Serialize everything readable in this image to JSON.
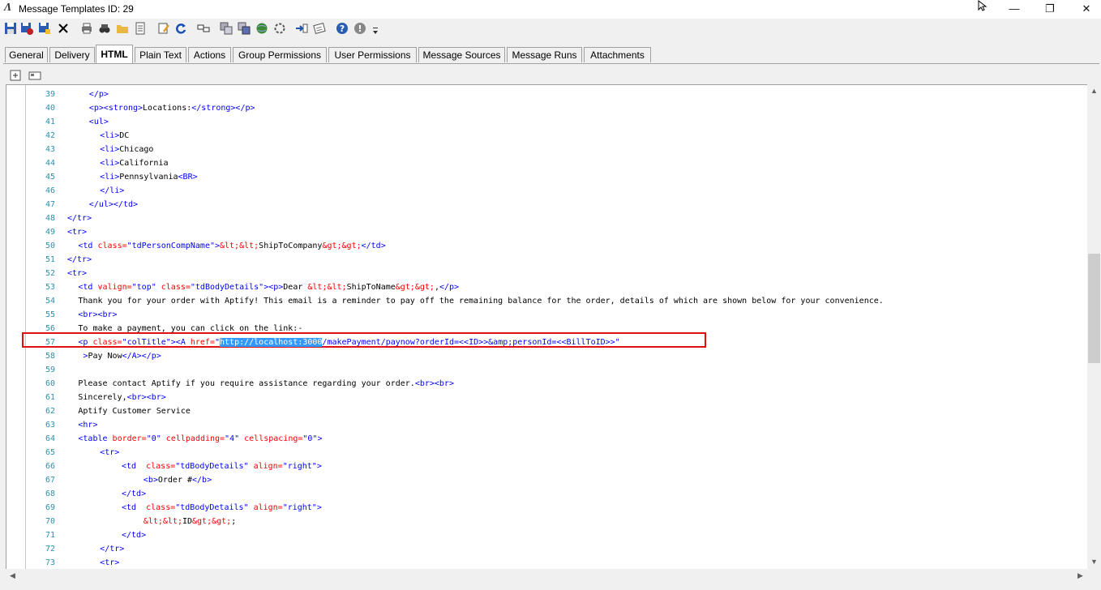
{
  "window": {
    "title": "Message Templates ID: 29",
    "minimize": "—",
    "restore": "❐",
    "close": "✕"
  },
  "toolbar": {
    "icons": [
      "save-icon",
      "save-close-icon",
      "save-new-icon",
      "delete-icon",
      "print-icon",
      "find-icon",
      "open-folder-icon",
      "properties-icon",
      "edit-icon",
      "refresh-icon",
      "link-icon",
      "copy-icon",
      "paste-icon",
      "web-icon",
      "settings-icon",
      "import-icon",
      "notes-icon",
      "help-icon",
      "info-icon",
      "dropdown-icon"
    ]
  },
  "tabs": [
    {
      "label": "General",
      "active": false
    },
    {
      "label": "Delivery",
      "active": false
    },
    {
      "label": "HTML",
      "active": true
    },
    {
      "label": "Plain Text",
      "active": false
    },
    {
      "label": "Actions",
      "active": false
    },
    {
      "label": "Group Permissions",
      "active": false
    },
    {
      "label": "User Permissions",
      "active": false
    },
    {
      "label": "Message Sources",
      "active": false
    },
    {
      "label": "Message Runs",
      "active": false
    },
    {
      "label": "Attachments",
      "active": false
    }
  ],
  "editor": {
    "lines": [
      {
        "n": "39",
        "indent": 2,
        "parts": [
          [
            "t",
            "</p>"
          ]
        ]
      },
      {
        "n": "40",
        "indent": 2,
        "parts": [
          [
            "t",
            "<p><strong>"
          ],
          [
            "x",
            "Locations:"
          ],
          [
            "t",
            "</strong></p>"
          ]
        ]
      },
      {
        "n": "41",
        "indent": 2,
        "parts": [
          [
            "t",
            "<ul>"
          ]
        ]
      },
      {
        "n": "42",
        "indent": 3,
        "parts": [
          [
            "t",
            "<li>"
          ],
          [
            "x",
            "DC"
          ]
        ]
      },
      {
        "n": "43",
        "indent": 3,
        "parts": [
          [
            "t",
            "<li>"
          ],
          [
            "x",
            "Chicago"
          ]
        ]
      },
      {
        "n": "44",
        "indent": 3,
        "parts": [
          [
            "t",
            "<li>"
          ],
          [
            "x",
            "California"
          ]
        ]
      },
      {
        "n": "45",
        "indent": 3,
        "parts": [
          [
            "t",
            "<li>"
          ],
          [
            "x",
            "Pennsylvania"
          ],
          [
            "t",
            "<BR>"
          ]
        ]
      },
      {
        "n": "46",
        "indent": 3,
        "parts": [
          [
            "t",
            "</li>"
          ]
        ]
      },
      {
        "n": "47",
        "indent": 2,
        "parts": [
          [
            "t",
            "</ul></td>"
          ]
        ]
      },
      {
        "n": "48",
        "indent": 0,
        "parts": [
          [
            "t",
            "</tr>"
          ]
        ]
      },
      {
        "n": "49",
        "indent": 0,
        "parts": [
          [
            "t",
            "<tr>"
          ]
        ]
      },
      {
        "n": "50",
        "indent": 1,
        "parts": [
          [
            "t",
            "<td "
          ],
          [
            "a",
            "class="
          ],
          [
            "t",
            "\"tdPersonCompName\">"
          ],
          [
            "a",
            "&lt;&lt;"
          ],
          [
            "x",
            "ShipToCompany"
          ],
          [
            "a",
            "&gt;&gt;"
          ],
          [
            "t",
            "</td>"
          ]
        ]
      },
      {
        "n": "51",
        "indent": 0,
        "parts": [
          [
            "t",
            "</tr>"
          ]
        ]
      },
      {
        "n": "52",
        "indent": 0,
        "parts": [
          [
            "t",
            "<tr>"
          ]
        ]
      },
      {
        "n": "53",
        "indent": 1,
        "parts": [
          [
            "t",
            "<td "
          ],
          [
            "a",
            "valign="
          ],
          [
            "t",
            "\"top\" "
          ],
          [
            "a",
            "class="
          ],
          [
            "t",
            "\"tdBodyDetails\"><p>"
          ],
          [
            "x",
            "Dear "
          ],
          [
            "a",
            "&lt;&lt;"
          ],
          [
            "x",
            "ShipToName"
          ],
          [
            "a",
            "&gt;&gt;"
          ],
          [
            "x",
            ","
          ],
          [
            "t",
            "</p>"
          ]
        ]
      },
      {
        "n": "54",
        "indent": 1,
        "parts": [
          [
            "x",
            "Thank you for your order with Aptify! This email is a reminder to pay off the remaining balance for the order, details of which are shown below for your convenience."
          ]
        ]
      },
      {
        "n": "55",
        "indent": 1,
        "parts": [
          [
            "t",
            "<br><br>"
          ]
        ]
      },
      {
        "n": "56",
        "indent": 1,
        "parts": [
          [
            "x",
            "To make a payment, you can click on the link:-"
          ]
        ]
      },
      {
        "n": "57",
        "indent": 1,
        "parts": [
          [
            "t",
            "<p "
          ],
          [
            "a",
            "class="
          ],
          [
            "t",
            "\"colTitle\"><A "
          ],
          [
            "a",
            "href="
          ],
          [
            "t",
            "\""
          ],
          [
            "s",
            "http://localhost:3000"
          ],
          [
            "t",
            "/makePayment/paynow?orderId=<<ID>>&amp;personId=<<BillToID>>\""
          ]
        ]
      },
      {
        "n": "58",
        "indent": 1,
        "pad": " ",
        "parts": [
          [
            "t",
            ">"
          ],
          [
            "x",
            "Pay Now"
          ],
          [
            "t",
            "</A></p>"
          ]
        ]
      },
      {
        "n": "59",
        "indent": 0,
        "parts": []
      },
      {
        "n": "60",
        "indent": 1,
        "parts": [
          [
            "x",
            "Please contact Aptify if you require assistance regarding your order."
          ],
          [
            "t",
            "<br><br>"
          ]
        ]
      },
      {
        "n": "61",
        "indent": 1,
        "parts": [
          [
            "x",
            "Sincerely,"
          ],
          [
            "t",
            "<br><br>"
          ]
        ]
      },
      {
        "n": "62",
        "indent": 1,
        "parts": [
          [
            "x",
            "Aptify Customer Service"
          ]
        ]
      },
      {
        "n": "63",
        "indent": 1,
        "parts": [
          [
            "t",
            "<hr>"
          ]
        ]
      },
      {
        "n": "64",
        "indent": 1,
        "parts": [
          [
            "t",
            "<table "
          ],
          [
            "a",
            "border="
          ],
          [
            "t",
            "\"0\" "
          ],
          [
            "a",
            "cellpadding="
          ],
          [
            "t",
            "\"4\" "
          ],
          [
            "a",
            "cellspacing="
          ],
          [
            "t",
            "\"0\">"
          ]
        ]
      },
      {
        "n": "65",
        "indent": 3,
        "parts": [
          [
            "t",
            "<tr>"
          ]
        ]
      },
      {
        "n": "66",
        "indent": 5,
        "parts": [
          [
            "t",
            "<td  "
          ],
          [
            "a",
            "class="
          ],
          [
            "t",
            "\"tdBodyDetails\" "
          ],
          [
            "a",
            "align="
          ],
          [
            "t",
            "\"right\">"
          ]
        ]
      },
      {
        "n": "67",
        "indent": 7,
        "parts": [
          [
            "t",
            "<b>"
          ],
          [
            "x",
            "Order #"
          ],
          [
            "t",
            "</b>"
          ]
        ]
      },
      {
        "n": "68",
        "indent": 5,
        "parts": [
          [
            "t",
            "</td>"
          ]
        ]
      },
      {
        "n": "69",
        "indent": 5,
        "parts": [
          [
            "t",
            "<td  "
          ],
          [
            "a",
            "class="
          ],
          [
            "t",
            "\"tdBodyDetails\" "
          ],
          [
            "a",
            "align="
          ],
          [
            "t",
            "\"right\">"
          ]
        ]
      },
      {
        "n": "70",
        "indent": 7,
        "parts": [
          [
            "a",
            "&lt;&lt;"
          ],
          [
            "x",
            "ID"
          ],
          [
            "a",
            "&gt;&gt;"
          ],
          [
            "x",
            ";"
          ]
        ]
      },
      {
        "n": "71",
        "indent": 5,
        "parts": [
          [
            "t",
            "</td>"
          ]
        ]
      },
      {
        "n": "72",
        "indent": 3,
        "parts": [
          [
            "t",
            "</tr>"
          ]
        ]
      },
      {
        "n": "73",
        "indent": 3,
        "parts": [
          [
            "t",
            "<tr>"
          ]
        ]
      }
    ]
  },
  "scroll": {
    "vertical_position": 0.34,
    "vertical_visible": 0.24
  }
}
